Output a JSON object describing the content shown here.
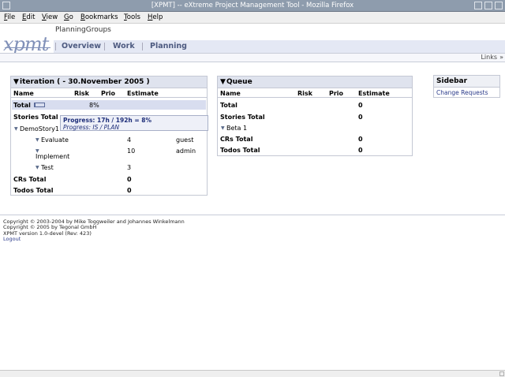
{
  "window": {
    "title": "[XPMT] -- eXtreme Project Management Tool - Mozilla Firefox"
  },
  "menu": [
    "File",
    "Edit",
    "View",
    "Go",
    "Bookmarks",
    "Tools",
    "Help"
  ],
  "header": {
    "logo_text": "xpmt",
    "project_name": "PlanningGroups",
    "tabs": [
      "Overview",
      "Work",
      "Planning"
    ]
  },
  "links_label": "Links",
  "iteration": {
    "title": "iteration  ( - 30.November 2005 )",
    "columns": [
      "Name",
      "Risk",
      "Prio",
      "Estimate"
    ],
    "total_label": "Total",
    "total_percent": "8%",
    "progress_fraction": 0.08,
    "stories_total_label": "Stories Total",
    "story_name": "DemoStory1",
    "tasks": [
      {
        "name": "Evaluate",
        "estimate": "4",
        "user": "guest"
      },
      {
        "name": "Implement",
        "estimate": "10",
        "user": "admin"
      },
      {
        "name": "Test",
        "estimate": "3",
        "user": ""
      }
    ],
    "crs_total_label": "CRs Total",
    "crs_total_value": "0",
    "todos_total_label": "Todos Total",
    "todos_total_value": "0",
    "tooltip_line1": "Progress: 17h / 192h = 8%",
    "tooltip_line2": "Progress: IS / PLAN"
  },
  "queue": {
    "title": "Queue",
    "columns": [
      "Name",
      "Risk",
      "Prio",
      "Estimate"
    ],
    "rows": [
      {
        "label": "Total",
        "value": "0"
      },
      {
        "label": "Stories Total",
        "value": "0"
      },
      {
        "label": "Beta 1",
        "value": ""
      },
      {
        "label": "CRs Total",
        "value": "0"
      },
      {
        "label": "Todos Total",
        "value": "0"
      }
    ]
  },
  "sidebar": {
    "title": "Sidebar",
    "link": "Change Requests"
  },
  "footer": {
    "line1": "Copyright © 2003-2004 by Mike Toggweiler and Johannes Winkelmann",
    "line2": "Copyright © 2005 by Tegonal GmbH",
    "line3": "XPMT version 1.0-devel (Rev: 423)",
    "logout": "Logout"
  }
}
